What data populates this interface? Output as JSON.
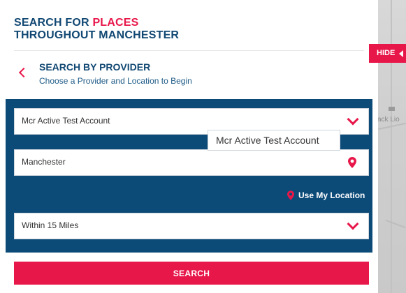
{
  "colors": {
    "brand_blue": "#114873",
    "form_blue": "#0c4a78",
    "accent_red": "#e8174a"
  },
  "header": {
    "title_prefix": "SEARCH FOR",
    "title_accent": "PLACES",
    "title_line2": "THROUGHOUT MANCHESTER"
  },
  "provider": {
    "title": "SEARCH BY PROVIDER",
    "subtitle": "Choose a Provider and Location to Begin",
    "back_icon": "chevron-left-icon"
  },
  "form": {
    "provider_select": {
      "value": "Mcr Active Test Account",
      "icon": "chevron-down-icon"
    },
    "location_input": {
      "value": "Manchester",
      "icon": "map-pin-icon"
    },
    "use_location_label": "Use My Location",
    "distance_select": {
      "value": "Within 15 Miles",
      "icon": "chevron-down-icon"
    },
    "tooltip": "Mcr Active Test Account"
  },
  "search_label": "SEARCH",
  "hide_label": "HIDE",
  "map": {
    "label": "ack Lio"
  }
}
